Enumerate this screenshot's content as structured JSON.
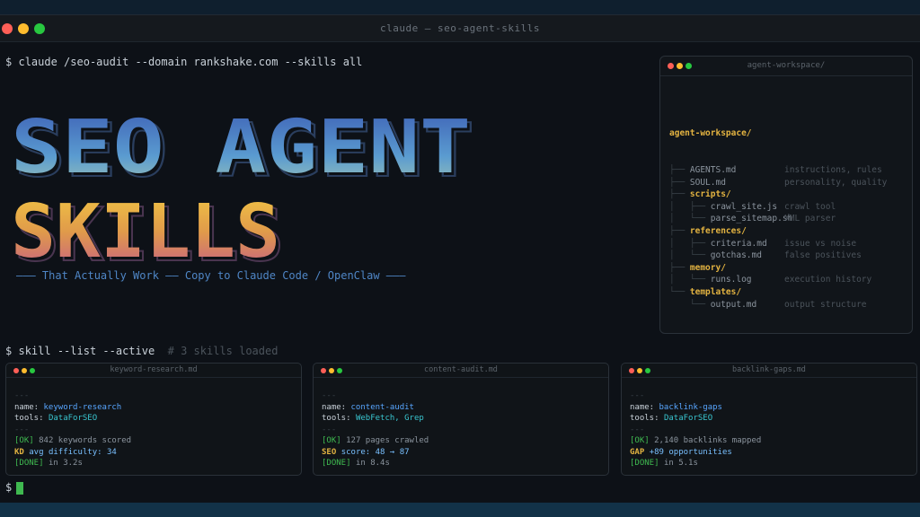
{
  "window": {
    "title": "claude — seo-agent-skills"
  },
  "command1": {
    "prompt": "$",
    "text": "claude /seo-audit --domain rankshake.com --skills all"
  },
  "banner": {
    "line1": "SEO AGENT",
    "line2": "SKILLS",
    "tagline": "——— That Actually Work —— Copy to Claude Code / OpenClaw ———"
  },
  "workspace": {
    "title": "agent-workspace/",
    "root": "agent-workspace/",
    "rows": [
      {
        "prefix": "├── ",
        "name": "AGENTS.md",
        "kind": "file",
        "note": "instructions, rules"
      },
      {
        "prefix": "├── ",
        "name": "SOUL.md",
        "kind": "file",
        "note": "personality, quality"
      },
      {
        "prefix": "├── ",
        "name": "scripts/",
        "kind": "dir",
        "note": ""
      },
      {
        "prefix": "│   ├── ",
        "name": "crawl_site.js",
        "kind": "file",
        "note": "crawl tool"
      },
      {
        "prefix": "│   └── ",
        "name": "parse_sitemap.sh",
        "kind": "file",
        "note": "XML parser"
      },
      {
        "prefix": "├── ",
        "name": "references/",
        "kind": "dir",
        "note": ""
      },
      {
        "prefix": "│   ├── ",
        "name": "criteria.md",
        "kind": "file",
        "note": "issue vs noise"
      },
      {
        "prefix": "│   └── ",
        "name": "gotchas.md",
        "kind": "file",
        "note": "false positives"
      },
      {
        "prefix": "├── ",
        "name": "memory/",
        "kind": "dir",
        "note": ""
      },
      {
        "prefix": "│   └── ",
        "name": "runs.log",
        "kind": "file",
        "note": "execution history"
      },
      {
        "prefix": "└── ",
        "name": "templates/",
        "kind": "dir",
        "note": ""
      },
      {
        "prefix": "    └── ",
        "name": "output.md",
        "kind": "file",
        "note": "output structure"
      }
    ]
  },
  "command2": {
    "prompt": "$",
    "text": "skill --list --active",
    "comment": "# 3 skills loaded"
  },
  "cards": [
    {
      "title": "keyword-research.md",
      "dash": "---",
      "name_key": "name:",
      "name": "keyword-research",
      "tools_key": "tools:",
      "tools": "DataForSEO",
      "ok_tag": "[OK]",
      "ok_text": "842 keywords scored",
      "metric_key": "KD",
      "metric_val": "avg difficulty: 34",
      "done_tag": "[DONE]",
      "done_text": "in 3.2s"
    },
    {
      "title": "content-audit.md",
      "dash": "---",
      "name_key": "name:",
      "name": "content-audit",
      "tools_key": "tools:",
      "tools": "WebFetch, Grep",
      "ok_tag": "[OK]",
      "ok_text": "127 pages crawled",
      "metric_key": "SEO",
      "metric_val": "score: 48 → 87",
      "done_tag": "[DONE]",
      "done_text": "in 8.4s"
    },
    {
      "title": "backlink-gaps.md",
      "dash": "---",
      "name_key": "name:",
      "name": "backlink-gaps",
      "tools_key": "tools:",
      "tools": "DataForSEO",
      "ok_tag": "[OK]",
      "ok_text": "2,140 backlinks mapped",
      "metric_key": "GAP",
      "metric_val": "+89 opportunities",
      "done_tag": "[DONE]",
      "done_text": "in 5.1s"
    }
  ],
  "final_prompt": "$",
  "colors": {
    "blue": "#3d6fc0",
    "gold": "#e6a93a",
    "pink": "#c46a8a"
  }
}
